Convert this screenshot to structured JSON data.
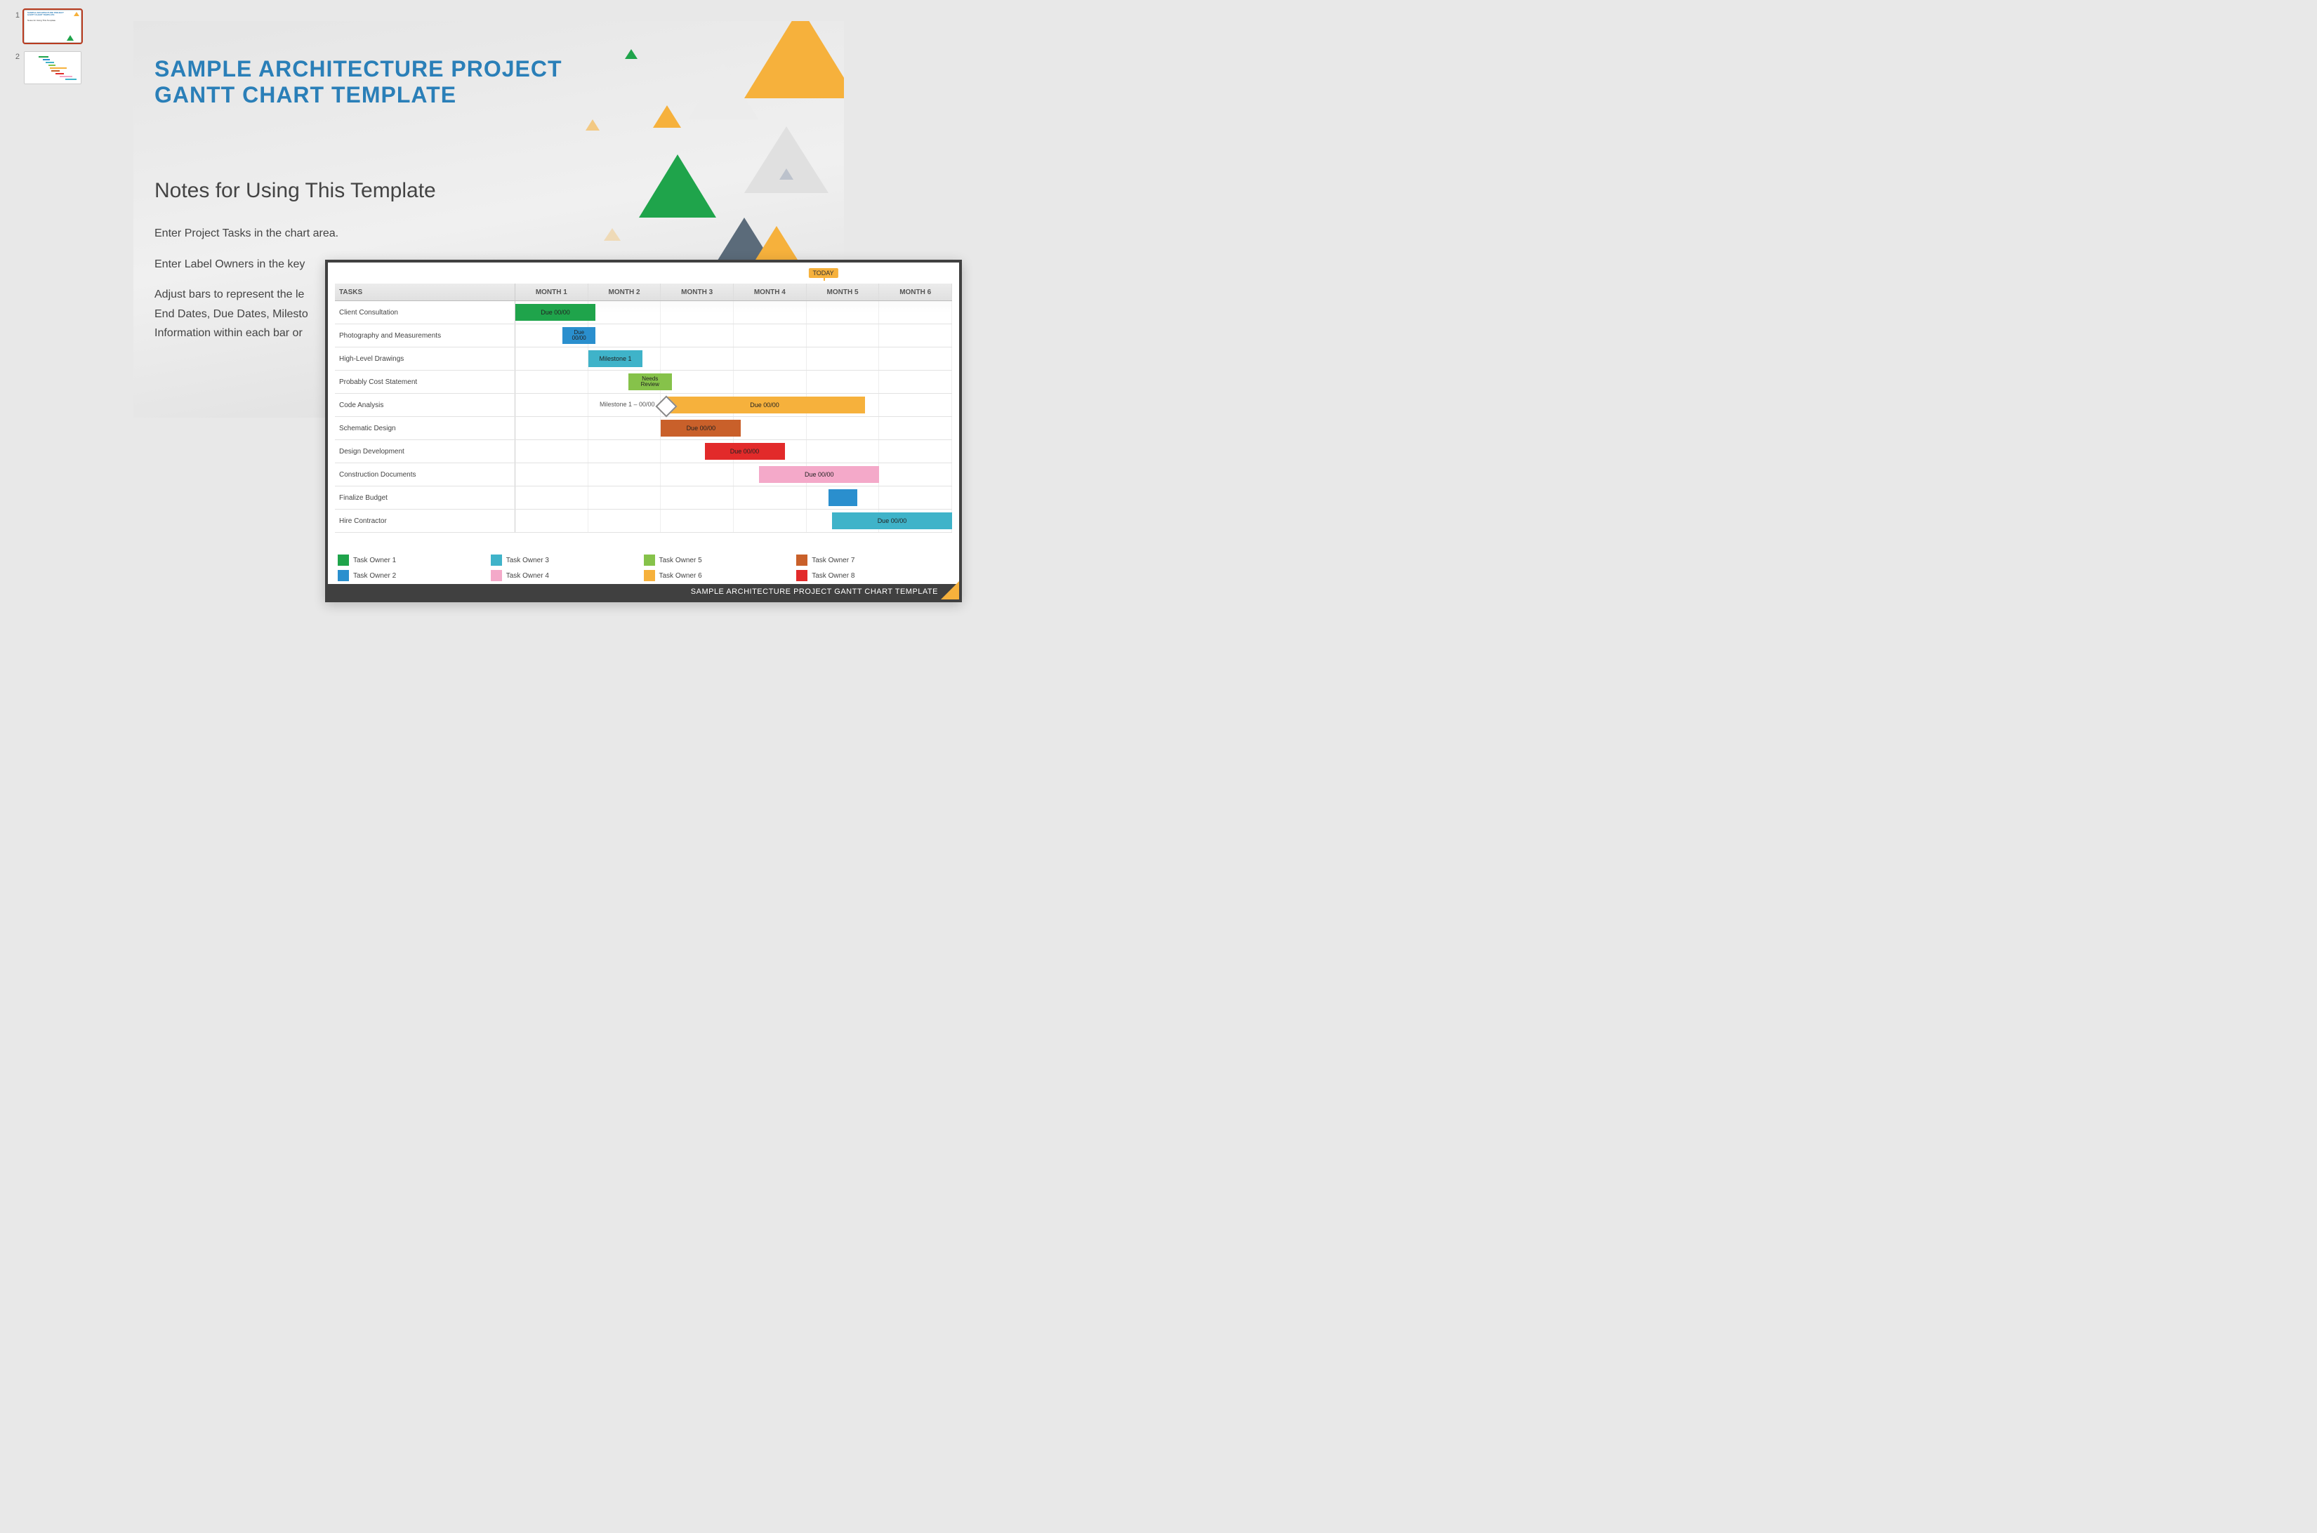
{
  "thumbnails": [
    {
      "index": "1",
      "selected": true
    },
    {
      "index": "2",
      "selected": false
    }
  ],
  "slide1": {
    "title_line1": "SAMPLE ARCHITECTURE PROJECT",
    "title_line2": "GANTT CHART TEMPLATE",
    "subtitle": "Notes for Using This Template",
    "para1": "Enter Project Tasks in the chart area.",
    "para2": "Enter Label Owners in the key",
    "para3": "Adjust bars to represent the le",
    "para4": "End Dates, Due Dates, Milesto",
    "para5": "Information within each bar or"
  },
  "slide2": {
    "today_label": "TODAY",
    "tasks_header": "TASKS",
    "footer": "SAMPLE ARCHITECTURE PROJECT GANTT CHART TEMPLATE"
  },
  "chart_data": {
    "type": "gantt",
    "title": "Sample Architecture Project Gantt Chart",
    "months": [
      "MONTH 1",
      "MONTH 2",
      "MONTH 3",
      "MONTH 4",
      "MONTH 5",
      "MONTH 6"
    ],
    "today_position_months": 4.25,
    "tasks": [
      {
        "name": "Client Consultation",
        "start": 0.0,
        "end": 1.1,
        "color": "#1fa44b",
        "label": "Due 00/00"
      },
      {
        "name": "Photography and Measurements",
        "start": 0.65,
        "end": 1.1,
        "color": "#2a8fce",
        "label": "Due 00/00",
        "narrow": true
      },
      {
        "name": "High-Level Drawings",
        "start": 1.0,
        "end": 1.75,
        "color": "#3fb3c9",
        "label": "Milestone 1"
      },
      {
        "name": "Probably Cost Statement",
        "start": 1.55,
        "end": 2.15,
        "color": "#86c24a",
        "label": "Needs Review",
        "narrow": true
      },
      {
        "name": "Code Analysis",
        "start": 2.05,
        "end": 4.8,
        "color": "#f6b13c",
        "label": "Due 00/00",
        "milestone": {
          "at": 2.05,
          "label": "Milestone 1 – 00/00"
        }
      },
      {
        "name": "Schematic Design",
        "start": 2.0,
        "end": 3.1,
        "color": "#c9602a",
        "label": "Due 00/00"
      },
      {
        "name": "Design Development",
        "start": 2.6,
        "end": 3.7,
        "color": "#e22a2a",
        "label": "Due 00/00"
      },
      {
        "name": "Construction Documents",
        "start": 3.35,
        "end": 5.0,
        "color": "#f4a9c9",
        "label": "Due 00/00"
      },
      {
        "name": "Finalize Budget",
        "start": 4.3,
        "end": 4.7,
        "color": "#2a8fce",
        "label": ""
      },
      {
        "name": "Hire Contractor",
        "start": 4.35,
        "end": 6.0,
        "color": "#3fb3c9",
        "label": "Due 00/00"
      }
    ],
    "legend": [
      {
        "label": "Task Owner 1",
        "color": "#1fa44b"
      },
      {
        "label": "Task Owner 3",
        "color": "#3fb3c9"
      },
      {
        "label": "Task Owner 5",
        "color": "#86c24a"
      },
      {
        "label": "Task Owner 7",
        "color": "#c9602a"
      },
      {
        "label": "Task Owner 2",
        "color": "#2a8fce"
      },
      {
        "label": "Task Owner 4",
        "color": "#f4a9c9"
      },
      {
        "label": "Task Owner 6",
        "color": "#f6b13c"
      },
      {
        "label": "Task Owner 8",
        "color": "#e22a2a"
      }
    ]
  }
}
